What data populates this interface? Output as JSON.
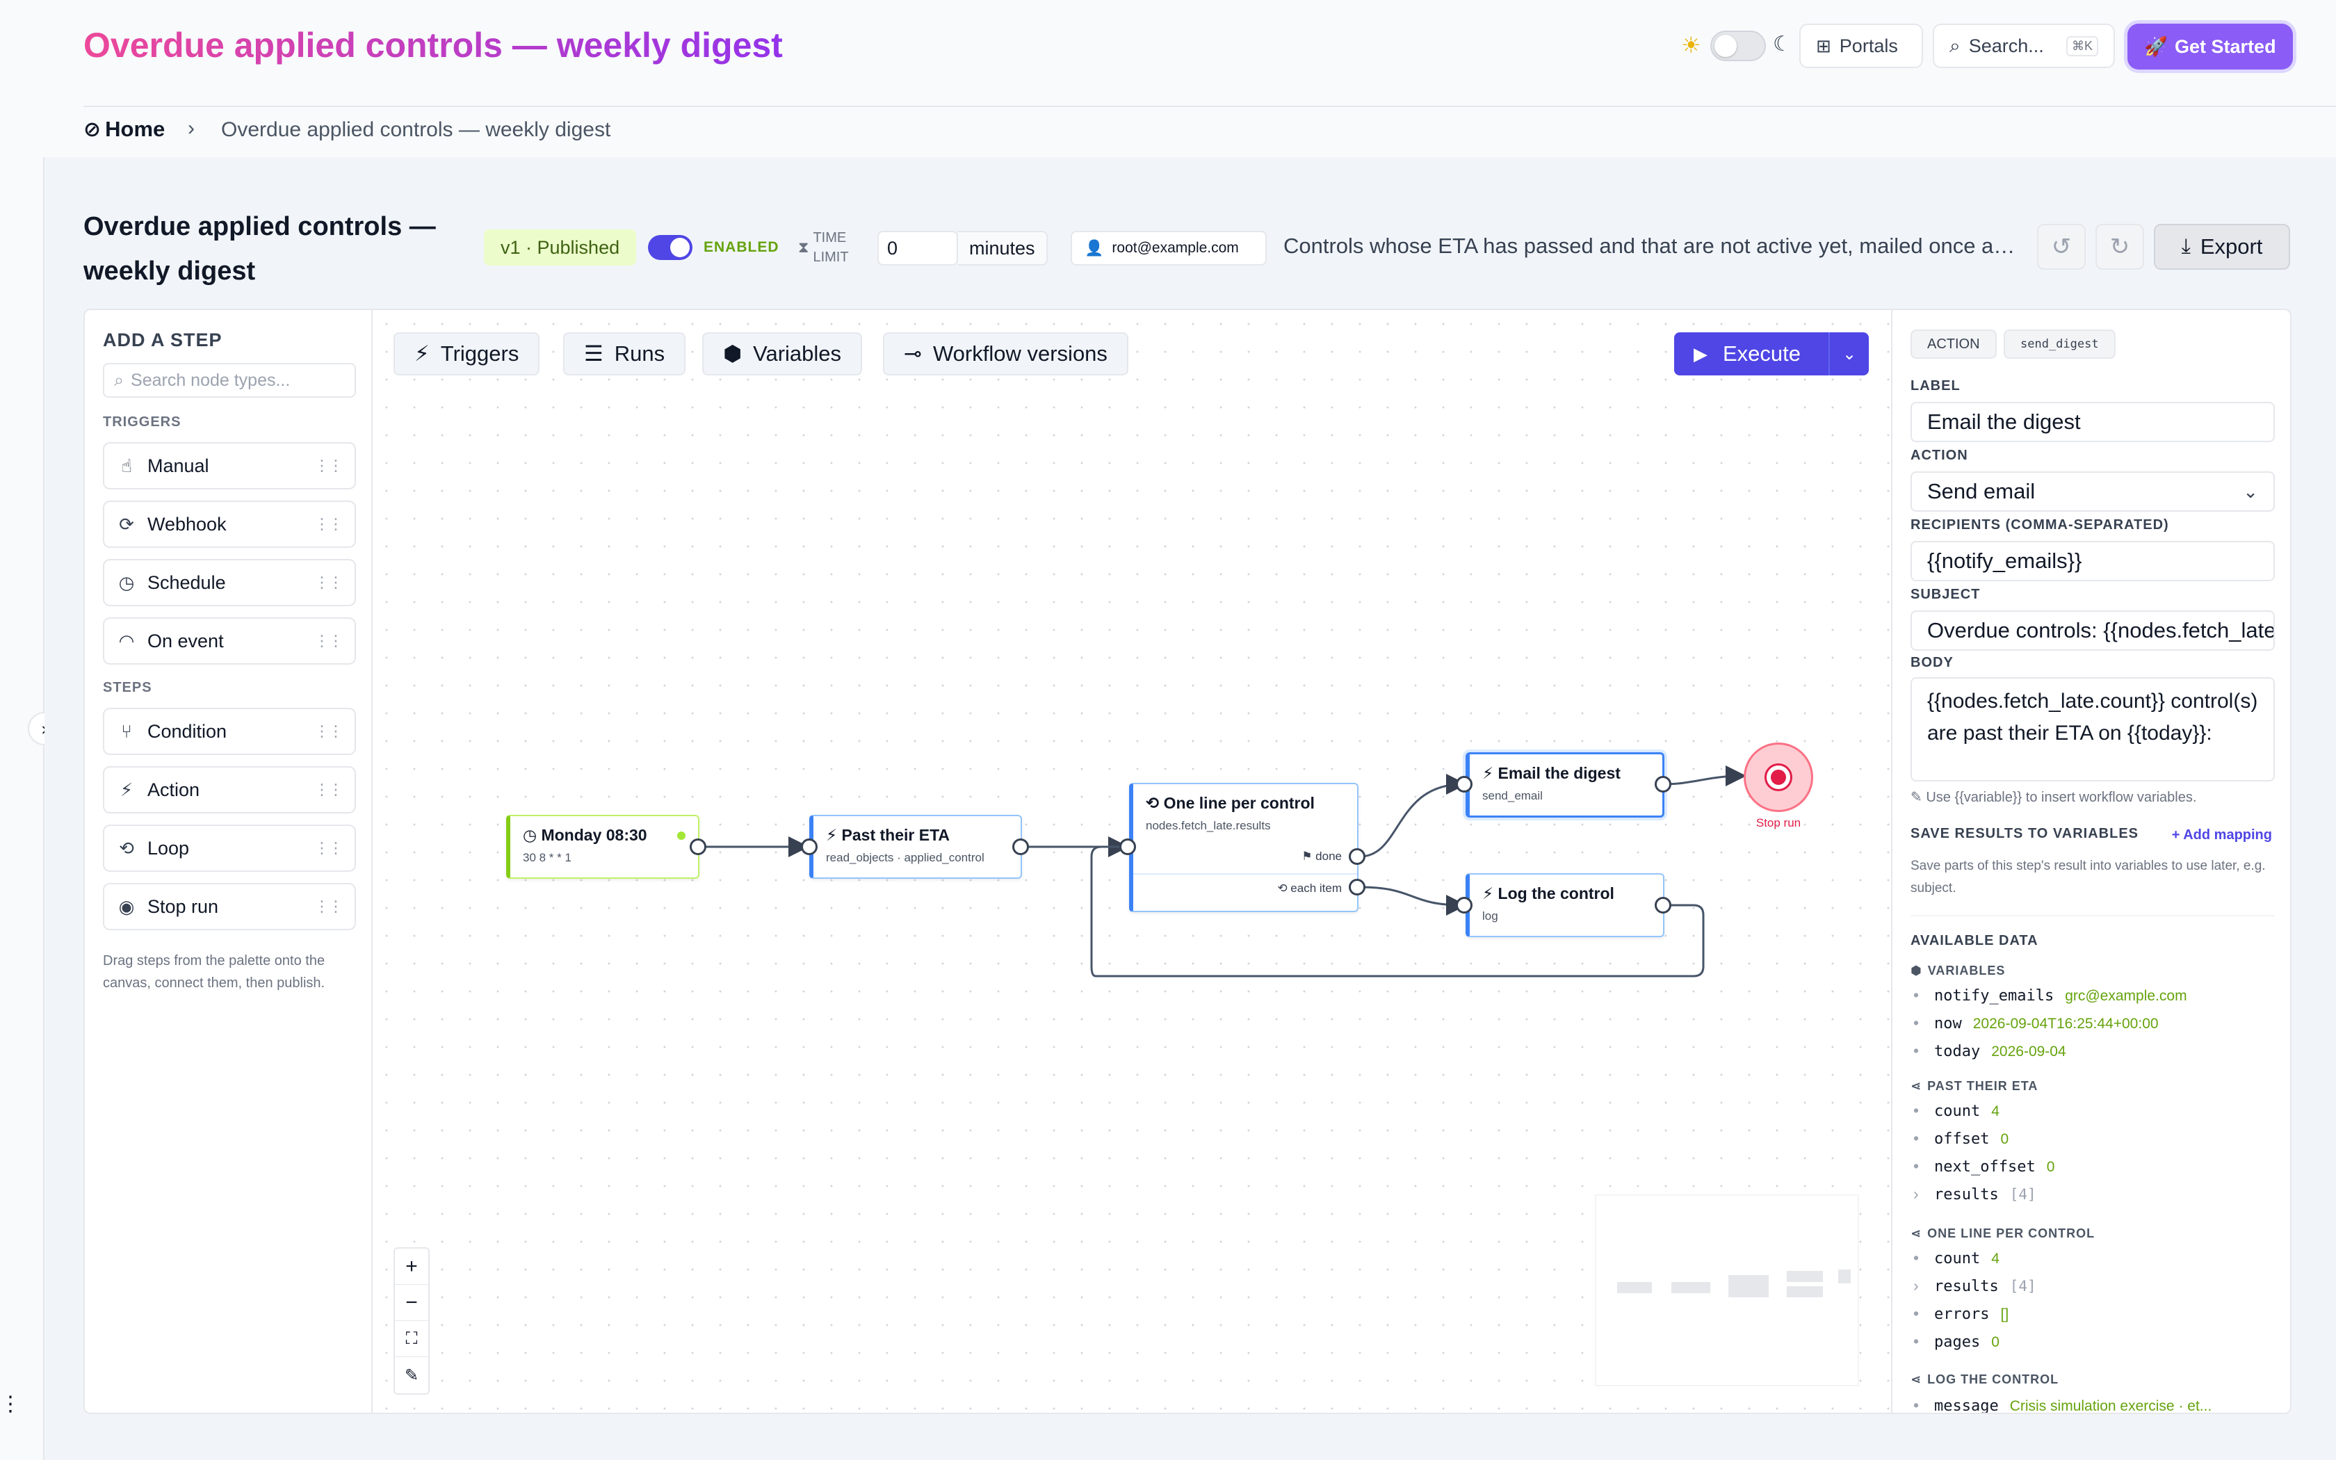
{
  "header": {
    "title": "Overdue applied controls — weekly digest",
    "portals_label": "Portals",
    "search_placeholder": "Search...",
    "search_shortcut": "⌘K",
    "cta_label": "Get Started"
  },
  "breadcrumb": {
    "home": "Home",
    "current": "Overdue applied controls — weekly digest"
  },
  "workflow": {
    "title": "Overdue applied controls — weekly digest",
    "version_badge": "v1 · Published",
    "enabled_label": "ENABLED",
    "time_limit_label": "TIME LIMIT",
    "time_limit_value": "0",
    "time_limit_unit": "minutes",
    "owner": "root@example.com",
    "description": "Controls whose ETA has passed and that are not active yet, mailed once a week",
    "export_label": "Export"
  },
  "palette": {
    "heading": "ADD A STEP",
    "search_placeholder": "Search node types...",
    "triggers_label": "TRIGGERS",
    "triggers": [
      "Manual",
      "Webhook",
      "Schedule",
      "On event"
    ],
    "steps_label": "STEPS",
    "steps": [
      "Condition",
      "Action",
      "Loop",
      "Stop run"
    ],
    "note": "Drag steps from the palette onto the canvas, connect them, then publish."
  },
  "canvas": {
    "tabs": [
      "Triggers",
      "Runs",
      "Variables",
      "Workflow versions"
    ],
    "execute_label": "Execute",
    "nodes": {
      "schedule": {
        "title": "Monday 08:30",
        "sub": "30 8 * * 1"
      },
      "fetch": {
        "title": "Past their ETA",
        "sub": "read_objects · applied_control"
      },
      "loop": {
        "title": "One line per control",
        "sub": "nodes.fetch_late.results",
        "done": "done",
        "each": "each item"
      },
      "email": {
        "title": "Email the digest",
        "sub": "send_email"
      },
      "log": {
        "title": "Log the control",
        "sub": "log"
      },
      "stop": {
        "label": "Stop run"
      }
    }
  },
  "inspector": {
    "type_chip": "ACTION",
    "id_chip": "send_digest",
    "label_label": "LABEL",
    "label_value": "Email the digest",
    "action_label": "ACTION",
    "action_value": "Send email",
    "recipients_label": "RECIPIENTS (COMMA-SEPARATED)",
    "recipients_value": "{{notify_emails}}",
    "subject_label": "SUBJECT",
    "subject_value": "Overdue controls: {{nodes.fetch_late.count}}",
    "body_label": "BODY",
    "body_value": "{{nodes.fetch_late.count}} control(s) are past their ETA on {{today}}:",
    "hint": "Use {{variable}} to insert workflow variables.",
    "save_heading": "SAVE RESULTS TO VARIABLES",
    "add_mapping": "+ Add mapping",
    "save_desc": "Save parts of this step's result into variables to use later, e.g. subject.",
    "available_heading": "AVAILABLE DATA",
    "groups": [
      {
        "title": "VARIABLES",
        "items": [
          {
            "key": "notify_emails",
            "value": "grc@example.com"
          },
          {
            "key": "now",
            "value": "2026-09-04T16:25:44+00:00"
          },
          {
            "key": "today",
            "value": "2026-09-04"
          }
        ]
      },
      {
        "title": "PAST THEIR ETA",
        "items": [
          {
            "key": "count",
            "value": "4"
          },
          {
            "key": "offset",
            "value": "0"
          },
          {
            "key": "next_offset",
            "value": "0"
          },
          {
            "key": "results",
            "value": "[4]"
          }
        ]
      },
      {
        "title": "ONE LINE PER CONTROL",
        "items": [
          {
            "key": "count",
            "value": "4"
          },
          {
            "key": "results",
            "value": "[4]"
          },
          {
            "key": "errors",
            "value": "[]"
          },
          {
            "key": "pages",
            "value": "0"
          }
        ]
      },
      {
        "title": "LOG THE CONTROL",
        "items": [
          {
            "key": "message",
            "value": "Crisis simulation exercise · et..."
          }
        ]
      }
    ]
  },
  "colors": {
    "accent": "#4f46e5",
    "brand_gradient_start": "#ec4899",
    "brand_gradient_end": "#9333ea",
    "enabled_green": "#65a30d",
    "stop_red": "#ef4444"
  }
}
